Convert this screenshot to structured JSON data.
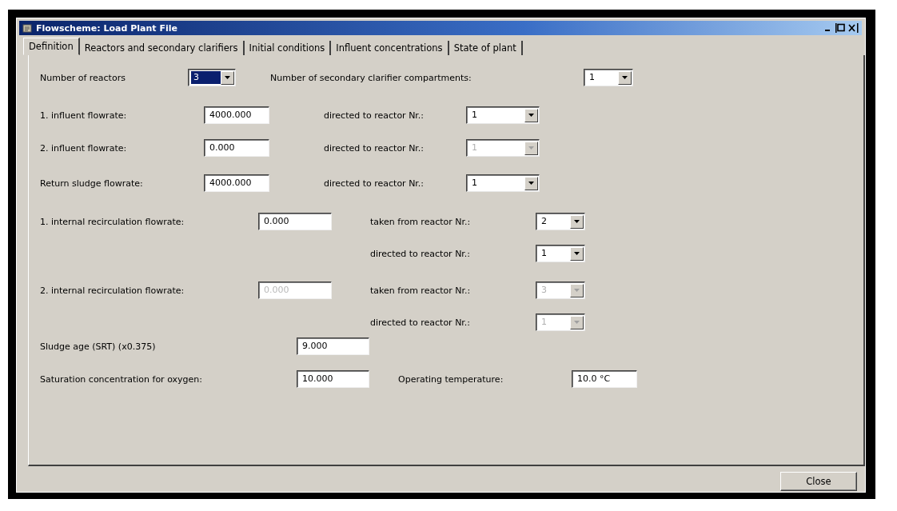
{
  "window": {
    "title": "Flowscheme: Load Plant File"
  },
  "tabs": [
    {
      "label": "Definition",
      "selected": true
    },
    {
      "label": "Reactors and secondary clarifiers",
      "selected": false
    },
    {
      "label": "Initial conditions",
      "selected": false
    },
    {
      "label": "Influent concentrations",
      "selected": false
    },
    {
      "label": "State of plant",
      "selected": false
    }
  ],
  "rows": [
    {
      "items": [
        {
          "kind": "label",
          "text": "Number of reactors"
        },
        {
          "kind": "select",
          "value": "3",
          "disabled": false,
          "focused": true
        },
        {
          "kind": "label",
          "text": "Number of secondary clarifier compartments:"
        },
        {
          "kind": "select",
          "value": "1",
          "disabled": false,
          "focused": false
        }
      ]
    },
    {
      "items": [
        {
          "kind": "label",
          "text": "1. influent flowrate:"
        },
        {
          "kind": "input",
          "value": "4000.000",
          "disabled": false
        },
        {
          "kind": "label",
          "text": "directed to reactor Nr.:"
        },
        {
          "kind": "select",
          "value": "1",
          "disabled": false,
          "focused": false
        }
      ]
    },
    {
      "items": [
        {
          "kind": "label",
          "text": "2. influent flowrate:"
        },
        {
          "kind": "input",
          "value": "0.000",
          "disabled": false
        },
        {
          "kind": "label",
          "text": "directed to reactor Nr.:"
        },
        {
          "kind": "select",
          "value": "1",
          "disabled": true,
          "focused": false
        }
      ]
    },
    {
      "items": [
        {
          "kind": "label",
          "text": "Return sludge flowrate:"
        },
        {
          "kind": "input",
          "value": "4000.000",
          "disabled": false
        },
        {
          "kind": "label",
          "text": "directed to reactor Nr.:"
        },
        {
          "kind": "select",
          "value": "1",
          "disabled": false,
          "focused": false
        }
      ]
    },
    {
      "items": [
        {
          "kind": "label",
          "text": "1. internal recirculation flowrate:"
        },
        {
          "kind": "input",
          "value": "0.000",
          "disabled": false
        },
        {
          "kind": "label",
          "text": "taken from reactor Nr.:"
        },
        {
          "kind": "select",
          "value": "2",
          "disabled": false,
          "focused": false
        }
      ]
    },
    {
      "items": [
        {
          "kind": "label",
          "text": "directed to reactor Nr.:"
        },
        {
          "kind": "select",
          "value": "1",
          "disabled": false,
          "focused": false
        }
      ]
    },
    {
      "items": [
        {
          "kind": "label",
          "text": "2. internal recirculation flowrate:"
        },
        {
          "kind": "input",
          "value": "0.000",
          "disabled": true
        },
        {
          "kind": "label",
          "text": "taken from reactor Nr.:"
        },
        {
          "kind": "select",
          "value": "3",
          "disabled": true,
          "focused": false
        }
      ]
    },
    {
      "items": [
        {
          "kind": "label",
          "text": "directed to reactor Nr.:"
        },
        {
          "kind": "select",
          "value": "1",
          "disabled": true,
          "focused": false
        }
      ]
    },
    {
      "items": [
        {
          "kind": "label",
          "text": "Sludge age (SRT) (x0.375)"
        },
        {
          "kind": "input",
          "value": "9.000",
          "disabled": false
        }
      ]
    },
    {
      "items": [
        {
          "kind": "label",
          "text": "Saturation concentration for oxygen:"
        },
        {
          "kind": "input",
          "value": "10.000",
          "disabled": false
        },
        {
          "kind": "label",
          "text": "Operating temperature:"
        },
        {
          "kind": "input",
          "value": "10.0 °C",
          "disabled": false
        }
      ]
    }
  ],
  "buttons": [
    {
      "label": "Close"
    }
  ]
}
